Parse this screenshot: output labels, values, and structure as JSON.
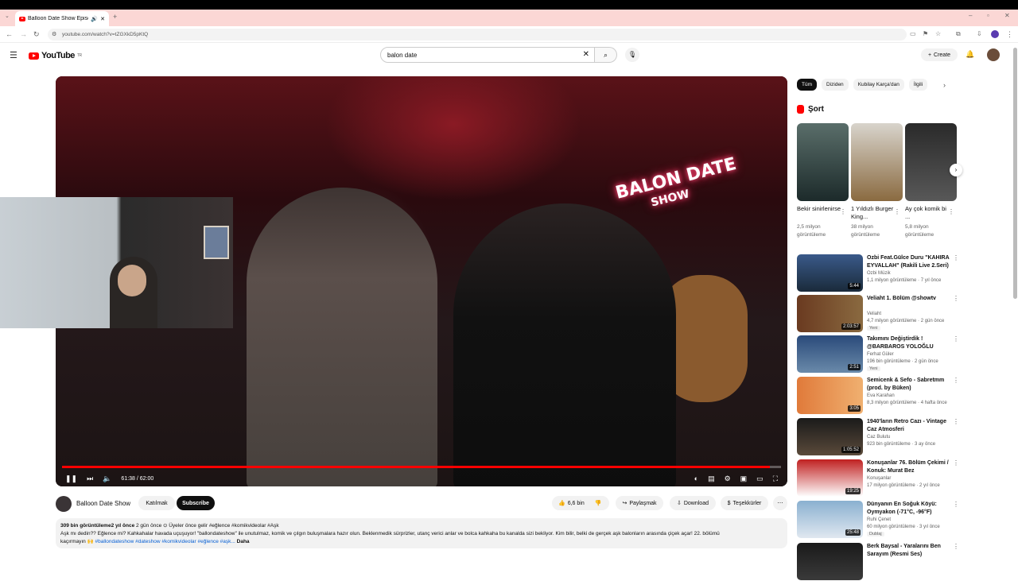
{
  "browser": {
    "tab_title": "Balloon Date Show Episod",
    "url": "youtube.com/watch?v=tZGXkD5pKtQ"
  },
  "header": {
    "logo_text": "YouTube",
    "logo_region": "TR",
    "search_value": "balon date",
    "create_label": "Create"
  },
  "player": {
    "time": "61:38 / 62:00",
    "progress": 0.985,
    "neon_line1": "BALON DATE",
    "neon_line2": "SHOW"
  },
  "channel": {
    "name": "Balloon Date Show",
    "join_label": "Katılmak",
    "subscribe_label": "Subscribe",
    "likes": "6,6 bin",
    "share_label": "Paylaşmak",
    "download_label": "Download",
    "thanks_label": "Teşekkürler"
  },
  "description": {
    "stats": "309 bin görüntüleme",
    "time": "2 yıl önce",
    "rest_meta": "2 gün önce  ⊙ Üyeler önce gelir  #eğlence #komikvideolar #Aşk",
    "line2": "Aşk mı dedin?? Eğlence mi? Kahkahalar havada uçuşuyor! \"ballondateshow\" ile unutulmaz, komik ve çılgın buluşmalara hazır olun. Beklenmedik sürprizler, utanç verici anlar ve bolca kahkaha bu kanalda sizi bekliyor. Kim bilir, belki de gerçek aşk balonların arasında çiçek açar! 22. bölümü",
    "line3_start": "kaçırmayın 🙌 ",
    "tags": "#ballondateshow #dateshow #komikvideolar #eğlence #aşk...",
    "more": "Daha"
  },
  "chips": [
    "Tüm",
    "Diziden",
    "Kubilay Karça'dan",
    "İlgili"
  ],
  "shorts": {
    "title": "Şort",
    "items": [
      {
        "title": "Bekir sinirlenirse",
        "views": "2,5 milyon görüntüleme"
      },
      {
        "title": "1 Yıldızlı Burger King...",
        "views": "38 milyon görüntüleme"
      },
      {
        "title": "Ay çok komik bi ...",
        "views": "5,8 milyon görüntüleme"
      }
    ]
  },
  "recommendations": [
    {
      "title": "Ozbi Feat.Gülce Duru \"KAHIRA EYVALLAH\" (Rakili Live 2.Seri)",
      "channel": "Ozbi Müzik",
      "meta": "1,1 milyon görüntüleme · 7 yıl önce",
      "duration": "5:44",
      "badge": ""
    },
    {
      "title": "Veliaht 1. Bölüm @showtv",
      "channel": "Veliaht",
      "meta": "4,7 milyon görüntüleme · 2 gün önce",
      "duration": "2:03:57",
      "badge": "Yeni"
    },
    {
      "title": "Takımını Değiştirdik ! @BARBAROS YOLOĞLU",
      "channel": "Ferhat Güler",
      "meta": "196 bin görüntüleme · 2 gün önce",
      "duration": "2:51",
      "badge": "Yeni"
    },
    {
      "title": "Semicenk & Sefo - Sabretmm (prod. by Büken)",
      "channel": "Eva Karahan",
      "meta": "8,3 milyon görüntüleme · 4 hafta önce",
      "duration": "3:05",
      "badge": ""
    },
    {
      "title": "1940'ların Retro Cazı - Vintage Caz Atmosferi",
      "channel": "Caz Bulutu",
      "meta": "923 bin görüntüleme · 3 ay önce",
      "duration": "1:05:52",
      "badge": ""
    },
    {
      "title": "Konuşanlar 76. Bölüm Çekimi / Konuk: Murat Bez",
      "channel": "Konuşanlar",
      "meta": "17 milyon görüntüleme · 2 yıl önce",
      "duration": "19:25",
      "badge": ""
    },
    {
      "title": "Dünyanın En Soğuk Köyü: Oymyakon (-71°C, -96°F)",
      "channel": "Ruhi Çenet",
      "meta": "60 milyon görüntüleme · 3 yıl önce",
      "duration": "25:48",
      "badge": "Dublaj"
    },
    {
      "title": "Berk Baysal - Yaralarını Ben Sarayım (Resmi Ses)",
      "channel": "",
      "meta": "",
      "duration": "",
      "badge": ""
    }
  ],
  "colors": {
    "brand_red": "#ff0000",
    "progress_red": "#ff0000",
    "link_blue": "#065fd4"
  }
}
